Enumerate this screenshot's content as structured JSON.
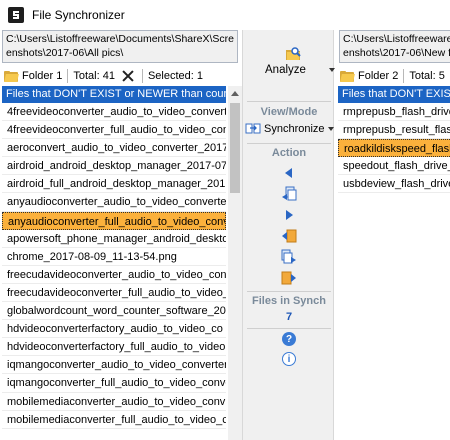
{
  "window": {
    "title": "File Synchronizer"
  },
  "left": {
    "path": "C:\\Users\\Listoffreeware\\Documents\\ShareX\\Scre\nenshots\\2017-06\\All pics\\",
    "folder_label": "Folder 1",
    "total": "Total: 41",
    "selected": "Selected: 1",
    "list_header": "Files that DON'T EXIST or NEWER than counte",
    "files": [
      "4freevideoconverter_audio_to_video_convert",
      "4freevideoconverter_full_audio_to_video_con",
      "aeroconvert_audio_to_video_converter_2017",
      "airdroid_android_desktop_manager_2017-07",
      "airdroid_full_android_desktop_manager_201",
      "anyaudioconverter_audio_to_video_converte",
      "anyaudioconverter_full_audio_to_video_conv",
      "apowersoft_phone_manager_android_deskto",
      "chrome_2017-08-09_11-13-54.png",
      "freecudavideoconverter_audio_to_video_con",
      "freecudavideoconverter_full_audio_to_video_",
      "globalwordcount_word_counter_software_20",
      "hdvideoconverterfactory_audio_to_video_co",
      "hdvideoconverterfactory_full_audio_to_video",
      "iqmangoconverter_audio_to_video_converter",
      "iqmangoconverter_full_audio_to_video_conve",
      "mobilemediaconverter_audio_to_video_conv",
      "mobilemediaconverter_full_audio_to_video_c"
    ],
    "selected_index": 6
  },
  "right": {
    "path": "C:\\Users\\Listoffreeware\\Sh\nenshots\\2017-06\\New fo",
    "folder_label": "Folder 2",
    "total": "Total: 5",
    "list_header": "Files that DON'T EXIST o",
    "files": [
      "rmprepusb_flash_drive_",
      "rmprepusb_result_flash",
      "roadkildiskspeed_flash",
      "speedout_flash_drive_s",
      "usbdeview_flash_drive_"
    ],
    "selected_index": 2
  },
  "middle": {
    "analyze_label": "Analyze",
    "view_mode_label": "View/Mode",
    "synchronize_label": "Synchronize",
    "action_label": "Action",
    "files_in_synch_label": "Files in Synch",
    "files_in_synch_count": "7",
    "help_glyph": "?",
    "info_glyph": "i"
  },
  "colors": {
    "header_blue": "#1c64c4",
    "selection_orange": "#fbb13c",
    "section_gray": "#7a8a9a",
    "count_blue": "#1c56b6"
  },
  "icons": [
    "app-icon",
    "folder-icon",
    "clear-x-icon",
    "analyze-icon",
    "synchronize-icon",
    "copy-left-icon",
    "copy-both-left-icon",
    "move-right-icon",
    "delete-left-icon",
    "copy-both-right-icon",
    "copy-right-icon",
    "help-icon",
    "info-icon"
  ]
}
